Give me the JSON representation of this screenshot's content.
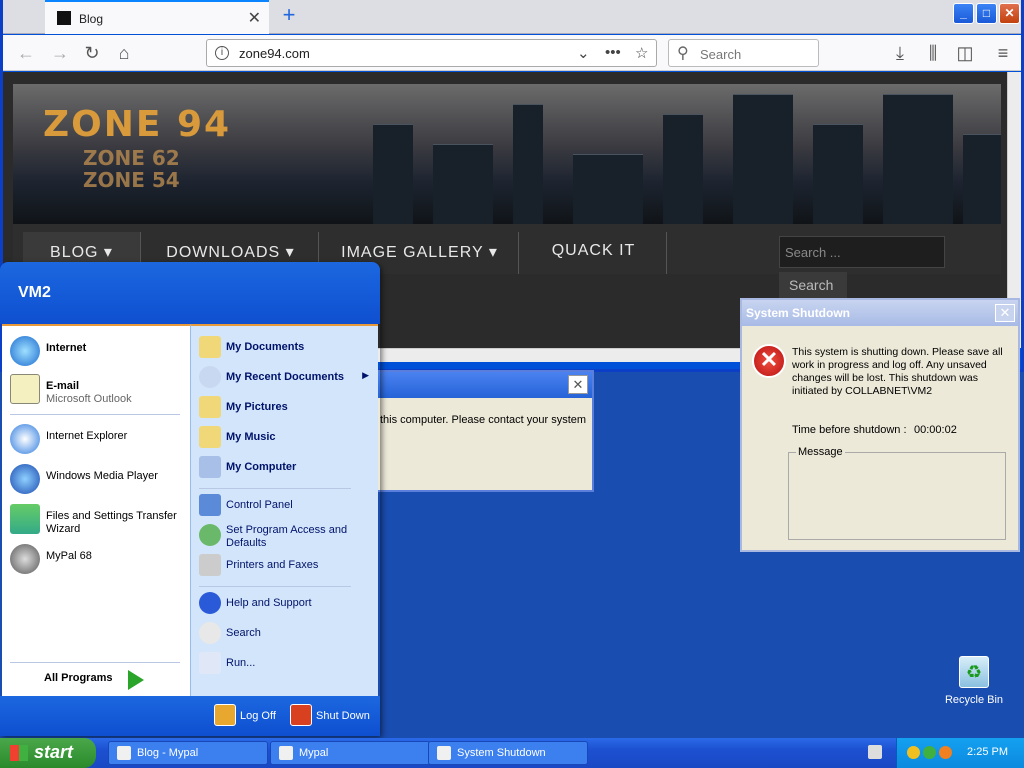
{
  "browser": {
    "tab_title": "Blog",
    "url": "zone94.com",
    "search_placeholder": "Search",
    "site": {
      "logo_main": "ZONE 94",
      "logo_sub1": "ZONE 62",
      "logo_sub2": "ZONE 54",
      "menu": [
        "BLOG",
        "DOWNLOADS",
        "IMAGE GALLERY",
        "QUACK IT"
      ],
      "search_placeholder": "Search ...",
      "search_button": "Search"
    }
  },
  "background_dialog": {
    "text": "this computer. Please contact your system"
  },
  "shutdown_dialog": {
    "title": "System Shutdown",
    "message": "This system is shutting down. Please save all work in progress and log off. Any unsaved changes will be lost. This shutdown was initiated by COLLABNET\\VM2",
    "time_label": "Time before shutdown :",
    "time_value": "00:00:02",
    "message_group_label": "Message"
  },
  "desktop": {
    "recycle_bin": "Recycle Bin"
  },
  "start_menu": {
    "user": "VM2",
    "left": [
      {
        "label": "Internet",
        "sub": "",
        "bold": true
      },
      {
        "label": "E-mail",
        "sub": "Microsoft Outlook",
        "bold": true
      },
      {
        "label": "Internet Explorer",
        "sub": ""
      },
      {
        "label": "Windows Media Player",
        "sub": ""
      },
      {
        "label": "Files and Settings Transfer",
        "sub": "Wizard"
      },
      {
        "label": "MyPal 68",
        "sub": ""
      }
    ],
    "all_programs": "All Programs",
    "right": [
      "My Documents",
      "My Recent Documents",
      "My Pictures",
      "My Music",
      "My Computer",
      "Control Panel",
      "Set Program Access and",
      "Defaults",
      "Printers and Faxes",
      "Help and Support",
      "Search",
      "Run..."
    ],
    "log_off": "Log Off",
    "shut_down": "Shut Down"
  },
  "taskbar": {
    "start": "start",
    "items": [
      "Blog - Mypal",
      "Mypal",
      "System Shutdown"
    ],
    "time": "2:25 PM"
  }
}
